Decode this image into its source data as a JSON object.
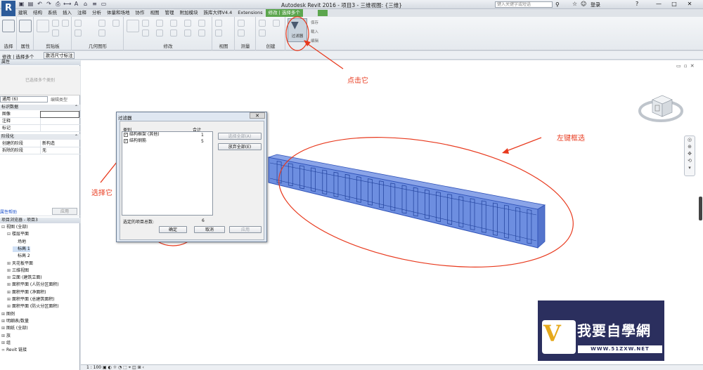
{
  "app": {
    "logo": "R",
    "title": "Autodesk Revit 2016 -   项目3 - 三维视图: {三维}",
    "search_placeholder": "键入关键字或短语",
    "login": "登录",
    "window_buttons": [
      "—",
      "□",
      "✕"
    ]
  },
  "tabs": [
    "建筑",
    "结构",
    "系统",
    "插入",
    "注释",
    "分析",
    "体量和场地",
    "协作",
    "视图",
    "管理",
    "附加模块",
    "族库大师V4.4",
    "Extensions",
    "修改 | 选择多个"
  ],
  "ribbon": {
    "panels": [
      "选择",
      "属性",
      "剪贴板",
      "几何图形",
      "修改",
      "视图",
      "测量",
      "创建"
    ],
    "filter_button": "过滤器",
    "right_small": [
      "保存",
      "载入",
      "编辑"
    ]
  },
  "context_bar": {
    "mode": "修改 | 选择多个",
    "button": "激活尺寸标注"
  },
  "properties": {
    "header": "属性",
    "preview": "已选择多个类别",
    "type_selector": "通用 (6)",
    "edit_type": "编辑类型",
    "sections": [
      {
        "name": "标识数据",
        "rows": [
          {
            "k": "图像",
            "v": ""
          },
          {
            "k": "注释",
            "v": ""
          },
          {
            "k": "标记",
            "v": ""
          }
        ]
      },
      {
        "name": "阶段化",
        "rows": [
          {
            "k": "创建的阶段",
            "v": "新构造"
          },
          {
            "k": "拆除的阶段",
            "v": "无"
          }
        ]
      }
    ],
    "help": "属性帮助",
    "apply": "应用"
  },
  "browser": {
    "header": "项目浏览器 - 项目3",
    "items": [
      {
        "t": "视图 (全部)",
        "d": 0,
        "g": "⊟"
      },
      {
        "t": "楼层平面",
        "d": 1,
        "g": "⊟"
      },
      {
        "t": "场地",
        "d": 2,
        "g": ""
      },
      {
        "t": "标高 1",
        "d": 2,
        "g": ""
      },
      {
        "t": "标高 2",
        "d": 2,
        "g": ""
      },
      {
        "t": "天花板平面",
        "d": 1,
        "g": "⊞"
      },
      {
        "t": "三维视图",
        "d": 1,
        "g": "⊞"
      },
      {
        "t": "立面 (建筑立面)",
        "d": 1,
        "g": "⊞"
      },
      {
        "t": "面积平面 (人防分区面积)",
        "d": 1,
        "g": "⊞"
      },
      {
        "t": "面积平面 (净面积)",
        "d": 1,
        "g": "⊞"
      },
      {
        "t": "面积平面 (总建筑面积)",
        "d": 1,
        "g": "⊞"
      },
      {
        "t": "面积平面 (防火分区面积)",
        "d": 1,
        "g": "⊞"
      },
      {
        "t": "图例",
        "d": 0,
        "g": "⊞"
      },
      {
        "t": "明细表/数量",
        "d": 0,
        "g": "⊞"
      },
      {
        "t": "图纸 (全部)",
        "d": 0,
        "g": "⊞"
      },
      {
        "t": "族",
        "d": 0,
        "g": "⊞"
      },
      {
        "t": "组",
        "d": 0,
        "g": "⊞"
      },
      {
        "t": "Revit 链接",
        "d": 0,
        "g": "∞"
      }
    ]
  },
  "dialog": {
    "title": "过滤器",
    "close": "✕",
    "col_category": "类别",
    "col_total": "合计",
    "items": [
      {
        "label": "结构框架 (其他)",
        "count": "1",
        "checked": "✓"
      },
      {
        "label": "结构钢筋",
        "count": "5",
        "checked": "✓"
      }
    ],
    "select_all": "选择全部(A)",
    "deselect_all": "放弃全部(E)",
    "total_label": "选定的项目总数:",
    "total_value": "6",
    "ok": "确定",
    "cancel": "取消",
    "apply": "应用"
  },
  "annotations": {
    "click_it": "点击它",
    "left_drag": "左键框选",
    "select_it": "选择它"
  },
  "watermark": {
    "title": "我要自學網",
    "url": "WWW.51ZXW.NET"
  },
  "status": {
    "scale": "1 : 100"
  },
  "colors": {
    "annotation": "#e8391d",
    "beam": "#4a72d6",
    "accent_tab": "#5ca64e"
  }
}
